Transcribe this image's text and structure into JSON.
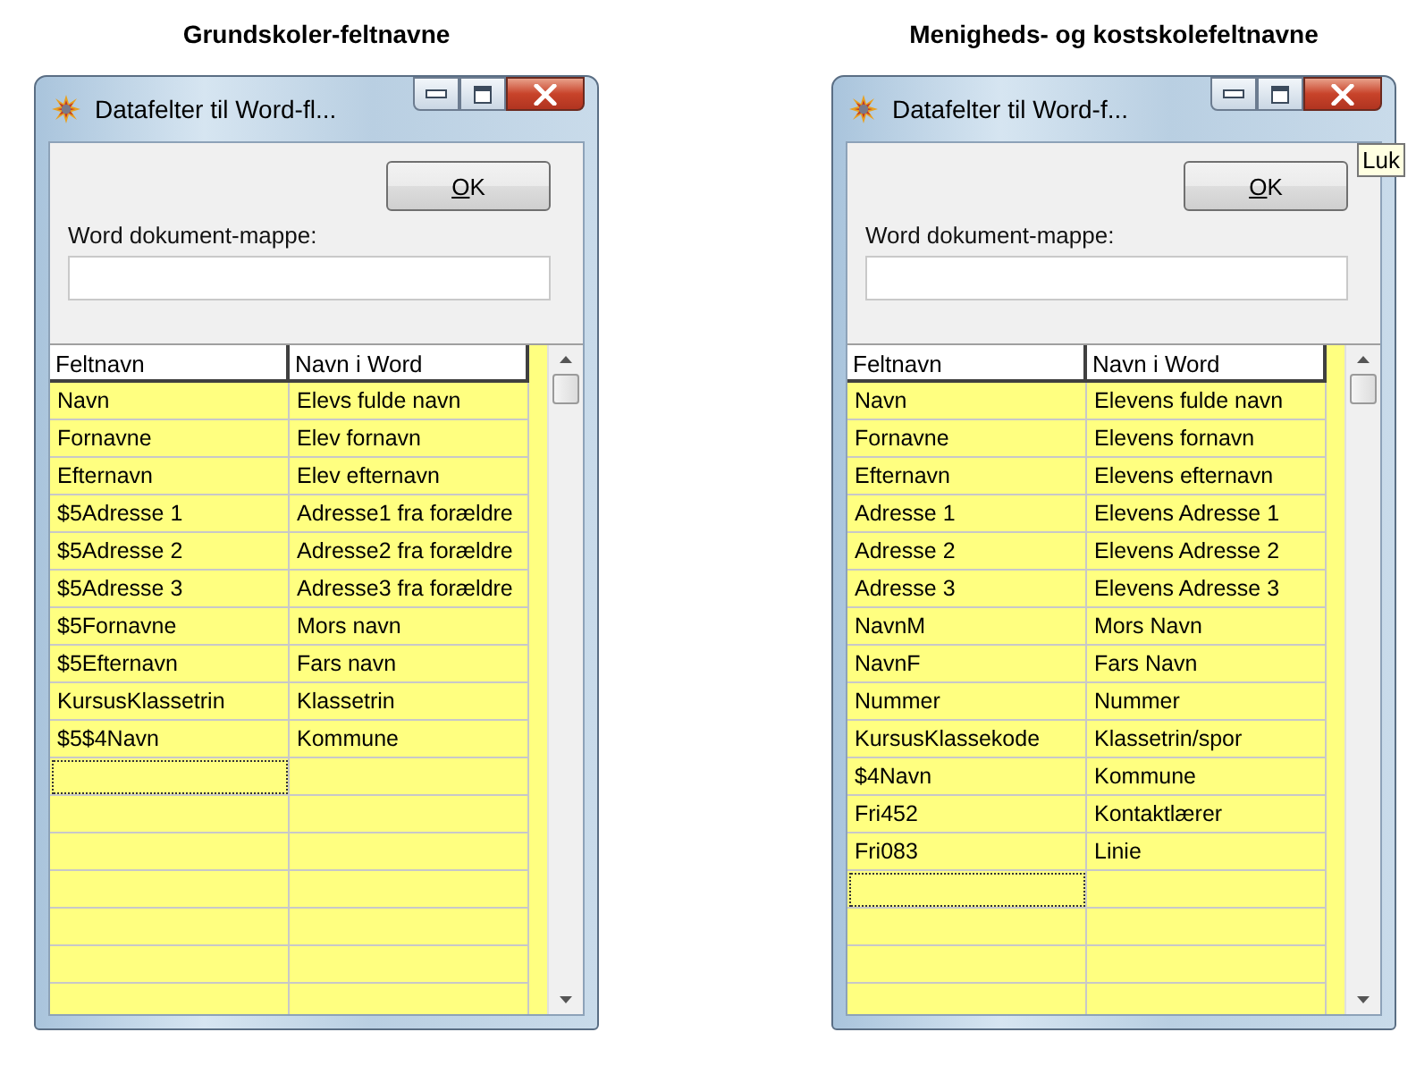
{
  "panels": [
    {
      "caption": "Grundskoler-feltnavne",
      "window": {
        "title": "Datafelter til Word-fl...",
        "ok_button": "OK",
        "folder_label": "Word dokument-mappe:",
        "columns": [
          "Feltnavn",
          "Navn i Word"
        ],
        "rows": [
          [
            "Navn",
            "Elevs fulde navn"
          ],
          [
            "Fornavne",
            "Elev fornavn"
          ],
          [
            "Efternavn",
            "Elev efternavn"
          ],
          [
            "$5Adresse 1",
            "Adresse1 fra forældre"
          ],
          [
            "$5Adresse 2",
            "Adresse2 fra forældre"
          ],
          [
            "$5Adresse 3",
            "Adresse3 fra forældre"
          ],
          [
            "$5Fornavne",
            "Mors navn"
          ],
          [
            "$5Efternavn",
            "Fars navn"
          ],
          [
            "KursusKlassetrin",
            "Klassetrin"
          ],
          [
            "$5$4Navn",
            "Kommune"
          ]
        ],
        "new_row_focused": true
      }
    },
    {
      "caption": "Menigheds- og kostskolefeltnavne",
      "window": {
        "title": "Datafelter til Word-f...",
        "ok_button": "OK",
        "folder_label": "Word dokument-mappe:",
        "columns": [
          "Feltnavn",
          "Navn i Word"
        ],
        "rows": [
          [
            "Navn",
            "Elevens fulde navn"
          ],
          [
            "Fornavne",
            "Elevens fornavn"
          ],
          [
            "Efternavn",
            "Elevens efternavn"
          ],
          [
            "Adresse 1",
            "Elevens Adresse 1"
          ],
          [
            "Adresse 2",
            "Elevens Adresse 2"
          ],
          [
            "Adresse 3",
            "Elevens Adresse 3"
          ],
          [
            "NavnM",
            "Mors Navn"
          ],
          [
            "NavnF",
            "Fars Navn"
          ],
          [
            "Nummer",
            "Nummer"
          ],
          [
            "KursusKlassekode",
            "Klassetrin/spor"
          ],
          [
            "$4Navn",
            "Kommune"
          ],
          [
            "Fri452",
            "Kontaktlærer"
          ],
          [
            "Fri083",
            "Linie"
          ]
        ],
        "new_row_focused": true,
        "tooltip": "Luk"
      }
    }
  ]
}
